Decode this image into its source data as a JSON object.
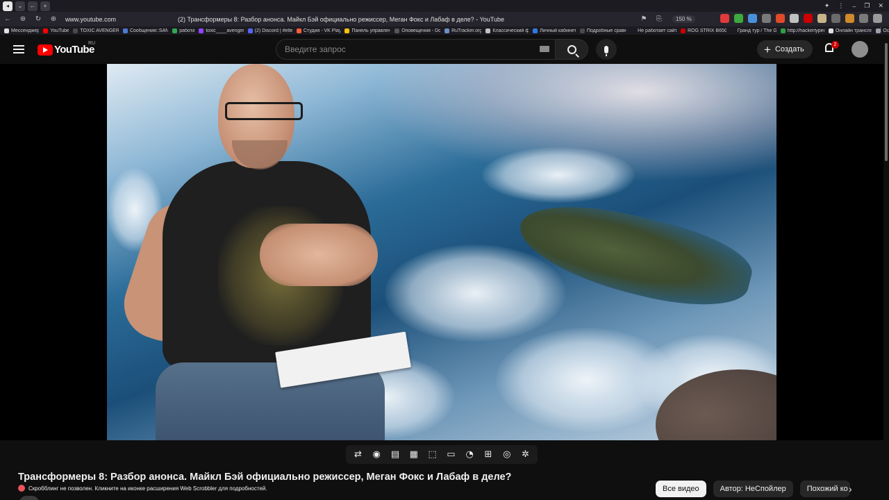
{
  "browser": {
    "url": "www.youtube.com",
    "page_title": "(2) Трансформеры 8: Разбор анонса. Майкл Бэй официально режиссер, Меган Фокс и Лабаф в деле? - YouTube",
    "zoom": "150 %",
    "bookmarks": [
      {
        "label": "Мессенджер",
        "color": "#e0e0e0"
      },
      {
        "label": "YouTube",
        "color": "#ff0000"
      },
      {
        "label": "TOXIC AVENGER",
        "color": "#4a4a4a"
      },
      {
        "label": "Сообщения::SAN",
        "color": "#4d7bd1"
      },
      {
        "label": "работа",
        "color": "#33a852"
      },
      {
        "label": "toxic____avenger",
        "color": "#9146ff"
      },
      {
        "label": "(2) Discord | #elte",
        "color": "#5865f2"
      },
      {
        "label": "Студия - VK Play",
        "color": "#ff5d3a"
      },
      {
        "label": "Панель управлен",
        "color": "#f4c20d"
      },
      {
        "label": "Оповещения - Do",
        "color": "#555555"
      },
      {
        "label": "RuTracker.org",
        "color": "#6b8fc4"
      },
      {
        "label": "Классический ф",
        "color": "#c0c0c0"
      },
      {
        "label": "Личный кабинет",
        "color": "#2f7ae5"
      },
      {
        "label": "Подробные сравн",
        "color": "#4a4a4a"
      },
      {
        "label": "Не работает сайт",
        "color": "#1c1b22"
      },
      {
        "label": "ROG STRIX B650",
        "color": "#cc0000"
      },
      {
        "label": "Гранд тур / The G",
        "color": "#1c1b22"
      },
      {
        "label": "http://hackertyper",
        "color": "#2ea043"
      },
      {
        "label": "Онлайн трансля",
        "color": "#e0e0e0"
      },
      {
        "label": "Ос",
        "color": "#9aa0a6"
      }
    ],
    "extension_colors": [
      "#e03a3a",
      "#3caa3c",
      "#4a90d9",
      "#7a7a7a",
      "#e04a2a",
      "#c0c0c0",
      "#cc0000",
      "#c8b48a",
      "#6b6b6b",
      "#d08a2a",
      "#7a7a7a",
      "#9a9a9a"
    ]
  },
  "header": {
    "logo_text": "YouTube",
    "region": "RU",
    "search_placeholder": "Введите запрос",
    "create_label": "Создать",
    "notification_count": "2"
  },
  "player": {
    "control_icons": [
      "loop-icon",
      "broadcast-icon",
      "playlist-icon",
      "cinema-mode-icon",
      "fullscreen-window-icon",
      "subtitles-icon",
      "speed-icon",
      "add-to-playlist-icon",
      "screenshot-icon",
      "settings-icon"
    ],
    "control_glyphs": [
      "⇄",
      "◉",
      "▤",
      "▦",
      "⬚",
      "▭",
      "◔",
      "⊞",
      "◎",
      "✲"
    ]
  },
  "video": {
    "title": "Трансформеры 8: Разбор анонса. Майкл Бэй официально режиссер, Меган Фокс и Лабаф в деле?",
    "scrobbler_message": "Скробблинг не позволен. Кликните на иконке расширения Web Scrobbler для подробностей."
  },
  "chips": [
    {
      "label": "Все видео",
      "selected": true
    },
    {
      "label": "Автор: НеСпойлер",
      "selected": false
    },
    {
      "label": "Похожий ко",
      "selected": false
    }
  ]
}
